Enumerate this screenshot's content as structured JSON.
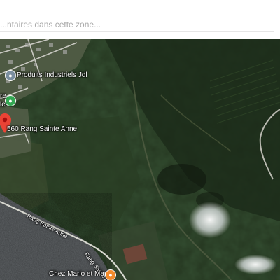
{
  "search": {
    "placeholder": "...ntaires dans cette zone..."
  },
  "map": {
    "view": "satellite",
    "selected_place": {
      "label": "560 Rang Sainte Anne",
      "marker_color": "#ea4335",
      "icon": "red-location-pin-icon"
    },
    "places": [
      {
        "label": "Produits Industriels Jdl",
        "icon": "store-icon",
        "icon_color": "#7b8fa0"
      },
      {
        "label": "Chez Mario et Mario",
        "icon": "restaurant-icon",
        "icon_color": "#f28b2c"
      }
    ],
    "partial_labels": [
      {
        "label": "re"
      },
      {
        "label": "le"
      }
    ],
    "park_pin": {
      "icon": "park-icon",
      "icon_color": "#34a853"
    },
    "roads": [
      {
        "name": "Rang Sainte Anne"
      },
      {
        "name": "Rang Sainte Anne"
      }
    ]
  }
}
